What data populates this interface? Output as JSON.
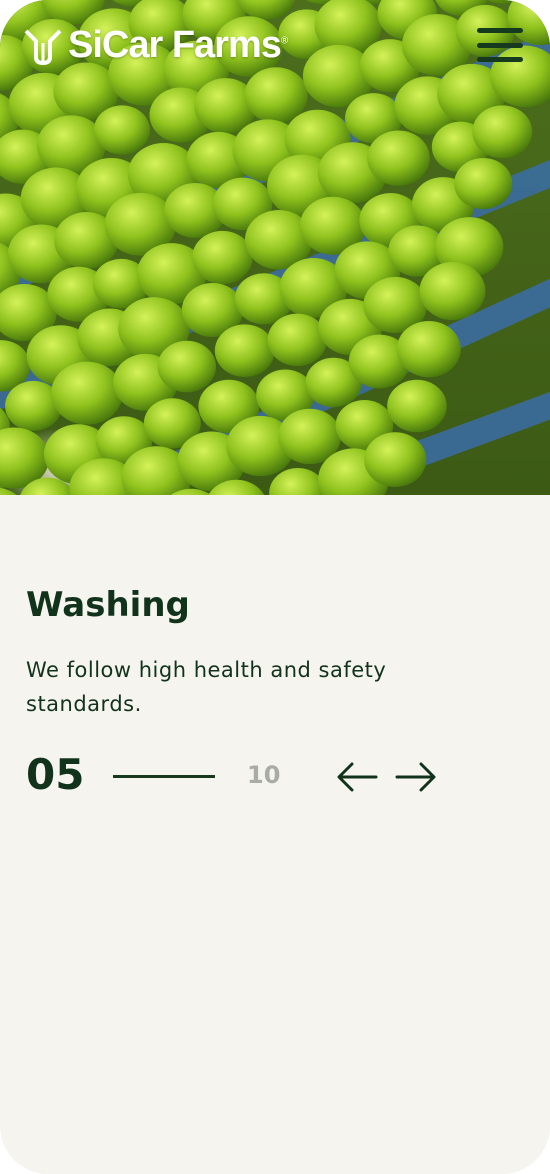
{
  "brand": {
    "name": "SiCar Farms",
    "trademark": "®"
  },
  "header": {
    "menu_icon": "hamburger-menu-icon"
  },
  "hero": {
    "image": "green limes on conveyor belt"
  },
  "slide": {
    "title": "Washing",
    "description": "We follow high health and safety standards.",
    "current": "05",
    "total": "10"
  },
  "controls": {
    "prev_icon": "arrow-left-icon",
    "next_icon": "arrow-right-icon"
  },
  "colors": {
    "dark_green": "#12331b",
    "muted_gray": "#a9aca5",
    "background": "#f5f4ef"
  }
}
